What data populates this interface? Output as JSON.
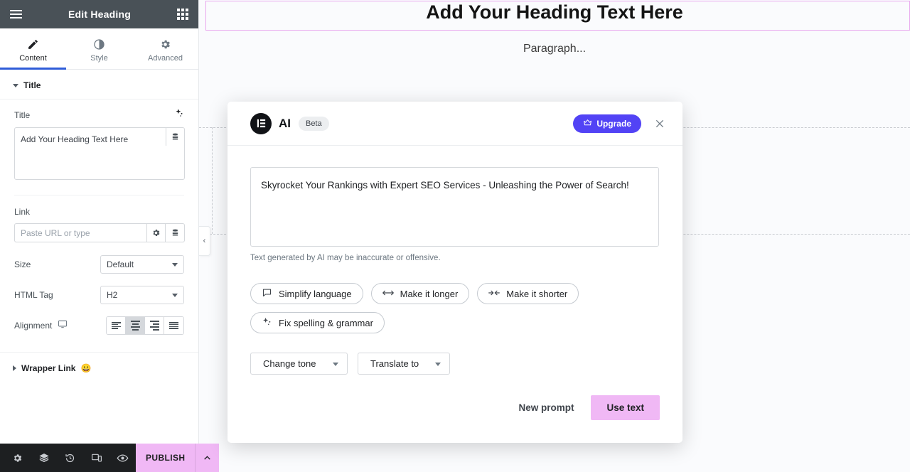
{
  "panel": {
    "header": {
      "title": "Edit Heading",
      "menu_icon": "hamburger-icon",
      "grid_icon": "grid-apps-icon"
    },
    "tabs": [
      {
        "label": "Content",
        "icon": "pencil-icon",
        "active": true
      },
      {
        "label": "Style",
        "icon": "contrast-circle-icon",
        "active": false
      },
      {
        "label": "Advanced",
        "icon": "gear-icon",
        "active": false
      }
    ],
    "sections": {
      "title_section": {
        "label": "Title",
        "expanded": true
      },
      "wrapper_link_section": {
        "label": "Wrapper Link",
        "badge": "😀",
        "expanded": false
      }
    },
    "controls": {
      "title_label": "Title",
      "title_value": "Add Your Heading Text Here",
      "title_ai_icon": "ai-sparkle-icon",
      "title_dynamic_icon": "dynamic-tags-icon",
      "link_label": "Link",
      "link_placeholder": "Paste URL or type",
      "link_settings_icon": "gear-icon",
      "link_dynamic_icon": "dynamic-tags-icon",
      "size_label": "Size",
      "size_value": "Default",
      "html_tag_label": "HTML Tag",
      "html_tag_value": "H2",
      "alignment_label": "Alignment",
      "alignment_device_icon": "desktop-monitor-icon",
      "alignment_options": [
        "left",
        "center",
        "right",
        "justify"
      ],
      "alignment_active": "center"
    }
  },
  "bottom_bar": {
    "icons": [
      {
        "name": "settings-gear-icon"
      },
      {
        "name": "navigator-layers-icon"
      },
      {
        "name": "history-clock-icon"
      },
      {
        "name": "responsive-mode-icon"
      },
      {
        "name": "preview-eye-icon"
      }
    ],
    "publish_label": "PUBLISH",
    "publish_chevron_icon": "chevron-up-icon",
    "publish_color": "#f0b8f5"
  },
  "canvas": {
    "heading_text": "Add Your Heading Text Here",
    "paragraph_text": "Paragraph...",
    "selection_border_color": "#e8a8ee",
    "background_color": "#fafbfd",
    "collapse_handle_icon": "chevron-left-icon"
  },
  "dialog": {
    "logo_icon": "elementor-logo-icon",
    "brand": "AI",
    "badge": "Beta",
    "upgrade_label": "Upgrade",
    "upgrade_icon": "crown-icon",
    "upgrade_color": "#5243f5",
    "close_icon": "close-x-icon",
    "result_text": "Skyrocket Your Rankings with Expert SEO Services - Unleashing the Power of Search!",
    "disclaimer": "Text generated by AI may be inaccurate or offensive.",
    "chips": [
      {
        "label": "Simplify language",
        "icon": "speech-bubble-icon"
      },
      {
        "label": "Make it longer",
        "icon": "expand-arrows-icon"
      },
      {
        "label": "Make it shorter",
        "icon": "contract-arrows-icon"
      },
      {
        "label": "Fix spelling & grammar",
        "icon": "sparkle-icon"
      }
    ],
    "dropdowns": [
      {
        "label": "Change tone"
      },
      {
        "label": "Translate to"
      }
    ],
    "new_prompt_label": "New prompt",
    "use_text_label": "Use text",
    "use_text_color": "#f0b8f5"
  }
}
